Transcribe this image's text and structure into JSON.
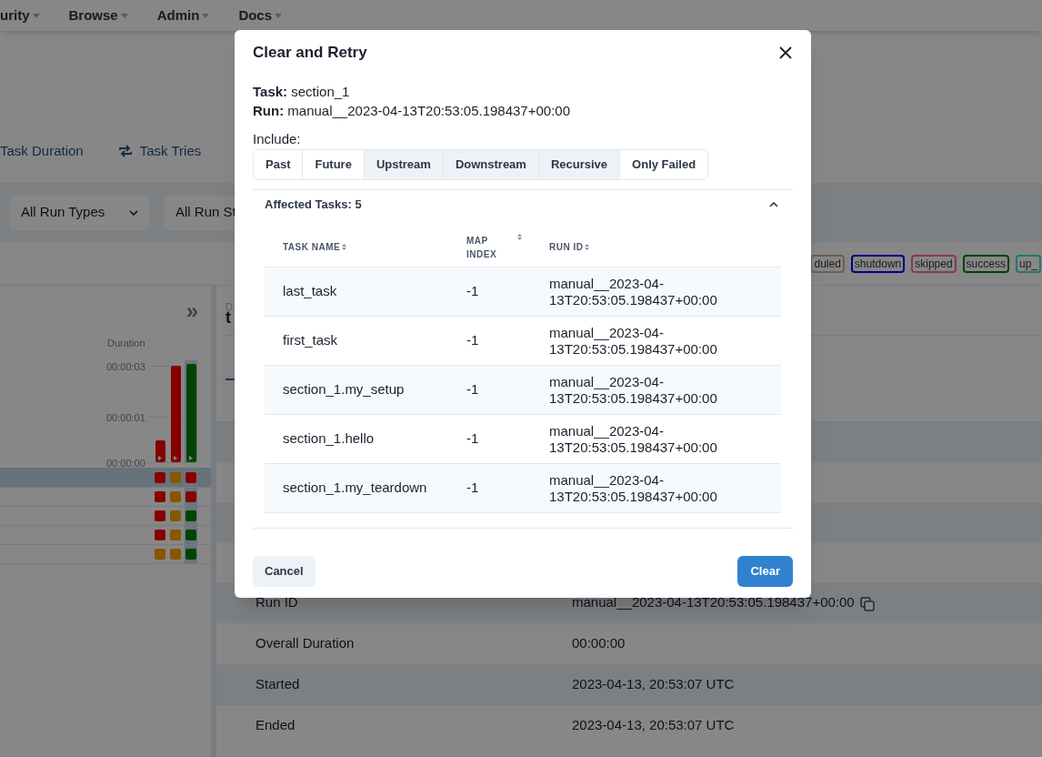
{
  "nav": {
    "items": [
      {
        "label": "urity"
      },
      {
        "label": "Browse"
      },
      {
        "label": "Admin"
      },
      {
        "label": "Docs"
      }
    ]
  },
  "view_tabs": [
    {
      "label": "Task Duration"
    },
    {
      "label": "Task Tries"
    }
  ],
  "filters": [
    {
      "label": "All Run Types"
    },
    {
      "label": "All Run St"
    }
  ],
  "legend": [
    {
      "label": "duled",
      "color": "#6f5f4a"
    },
    {
      "label": "shutdown",
      "color": "#000087"
    },
    {
      "label": "skipped",
      "color": "#87385f"
    },
    {
      "label": "success",
      "color": "#004400"
    },
    {
      "label": "up_",
      "color": "#22776e"
    }
  ],
  "grid": {
    "collapse_glyph": "»",
    "duration_label": "Duration",
    "ticks": [
      "00:00:03",
      "00:00:01",
      "00:00:00"
    ],
    "runs": [
      {
        "level": 0.22,
        "color": "#870000",
        "selected": false
      },
      {
        "level": 0.96,
        "color": "#870000",
        "selected": false
      },
      {
        "level": 0.98,
        "color": "#004400",
        "selected": true
      }
    ],
    "rows": [
      {
        "selected": true,
        "cells": [
          {
            "color": "#870000"
          },
          {
            "color": "#875700"
          },
          {
            "color": "#870000"
          }
        ]
      },
      {
        "selected": false,
        "cells": [
          {
            "color": "#870000"
          },
          {
            "color": "#875700"
          },
          {
            "color": "#870000"
          }
        ]
      },
      {
        "selected": false,
        "cells": [
          {
            "color": "#870000"
          },
          {
            "color": "#875700"
          },
          {
            "color": "#004400"
          }
        ]
      },
      {
        "selected": false,
        "cells": [
          {
            "color": "#870000"
          },
          {
            "color": "#875700"
          },
          {
            "color": "#004400"
          }
        ]
      },
      {
        "selected": false,
        "cells": [
          {
            "color": "#875700"
          },
          {
            "color": "#875700"
          },
          {
            "color": "#004400"
          }
        ]
      }
    ]
  },
  "details": {
    "overline": "D",
    "title": "t",
    "rows": [
      {
        "label": "Run ID",
        "value": "manual__2023-04-13T20:53:05.198437+00:00"
      },
      {
        "label": "Overall Duration",
        "value": "00:00:00"
      },
      {
        "label": "Started",
        "value": "2023-04-13, 20:53:07 UTC"
      },
      {
        "label": "Ended",
        "value": "2023-04-13, 20:53:07 UTC"
      }
    ]
  },
  "modal": {
    "title": "Clear and Retry",
    "task_label": "Task:",
    "task": "section_1",
    "run_label": "Run:",
    "run": "manual__2023-04-13T20:53:05.198437+00:00",
    "include_label": "Include:",
    "options": [
      {
        "label": "Past",
        "selected": false
      },
      {
        "label": "Future",
        "selected": false
      },
      {
        "label": "Upstream",
        "selected": true
      },
      {
        "label": "Downstream",
        "selected": true
      },
      {
        "label": "Recursive",
        "selected": true
      },
      {
        "label": "Only Failed",
        "selected": false
      }
    ],
    "affected": {
      "title": "Affected Tasks: 5",
      "expanded": true,
      "columns": [
        "TASK NAME",
        "MAP INDEX",
        "RUN ID"
      ],
      "rows": [
        [
          "last_task",
          "-1",
          "manual__2023-04-13T20:53:05.198437+00:00"
        ],
        [
          "first_task",
          "-1",
          "manual__2023-04-13T20:53:05.198437+00:00"
        ],
        [
          "section_1.my_setup",
          "-1",
          "manual__2023-04-13T20:53:05.198437+00:00"
        ],
        [
          "section_1.hello",
          "-1",
          "manual__2023-04-13T20:53:05.198437+00:00"
        ],
        [
          "section_1.my_teardown",
          "-1",
          "manual__2023-04-13T20:53:05.198437+00:00"
        ]
      ]
    },
    "buttons": {
      "cancel": "Cancel",
      "confirm": "Clear"
    }
  }
}
